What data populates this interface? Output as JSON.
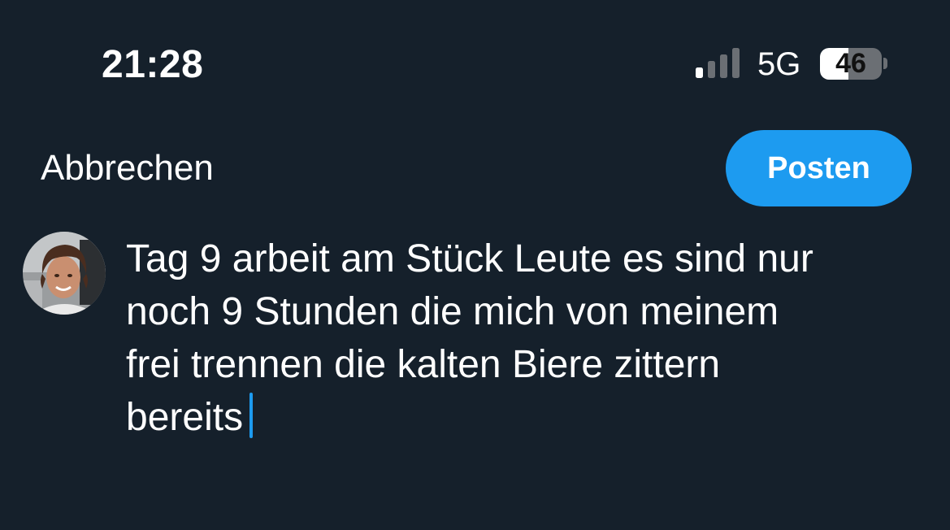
{
  "status_bar": {
    "time": "21:28",
    "network": "5G",
    "battery_level": "46",
    "battery_fraction": 0.46,
    "signal_bars_active": 1,
    "signal_bars_total": 4
  },
  "compose": {
    "cancel_label": "Abbrechen",
    "post_label": "Posten",
    "text_lines": [
      "Tag 9 arbeit am Stück Leute es sind nur",
      "noch 9 Stunden die mich von meinem",
      "frei trennen die kalten Biere zittern",
      "bereits"
    ]
  },
  "colors": {
    "background": "#15202b",
    "accent": "#1d9bf0",
    "text": "#ffffff"
  },
  "icons": {
    "signal": "cellular-signal-icon",
    "battery": "battery-icon",
    "avatar": "user-avatar"
  }
}
